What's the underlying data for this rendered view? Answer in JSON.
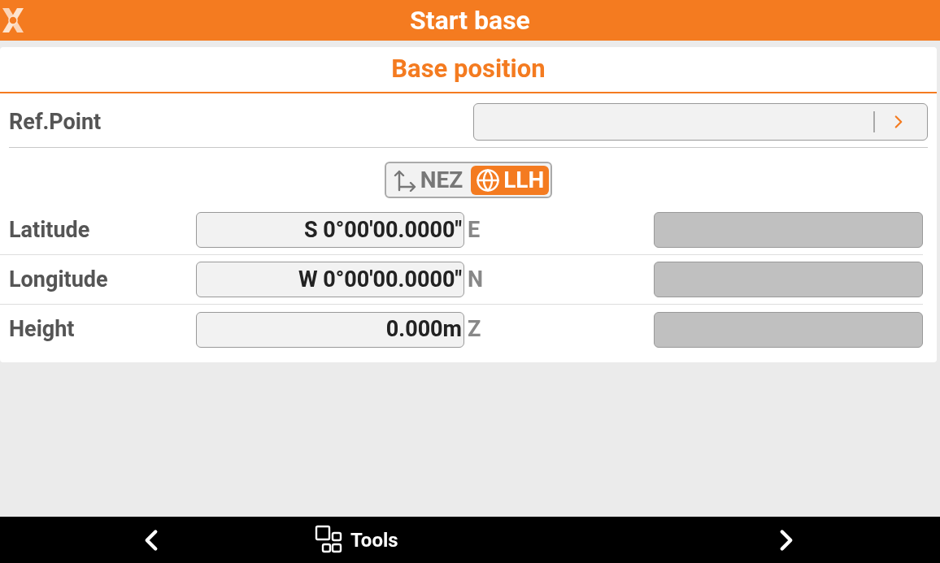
{
  "header": {
    "title": "Start base"
  },
  "section": {
    "title": "Base position"
  },
  "ref_point": {
    "label": "Ref.Point"
  },
  "mode_toggle": [
    {
      "label": "NEZ",
      "selected": false,
      "kind": "axes"
    },
    {
      "label": "LLH",
      "selected": true,
      "kind": "globe"
    }
  ],
  "coordinates": [
    {
      "label": "Latitude",
      "value": "S 0°00'00.0000\"",
      "grid_label": "E",
      "grid_disabled": true
    },
    {
      "label": "Longitude",
      "value": "W 0°00'00.0000\"",
      "grid_label": "N",
      "grid_disabled": true
    },
    {
      "label": "Height",
      "value": "0.000m",
      "grid_label": "Z",
      "grid_disabled": true
    }
  ],
  "bottom_bar": {
    "tools": "Tools"
  }
}
